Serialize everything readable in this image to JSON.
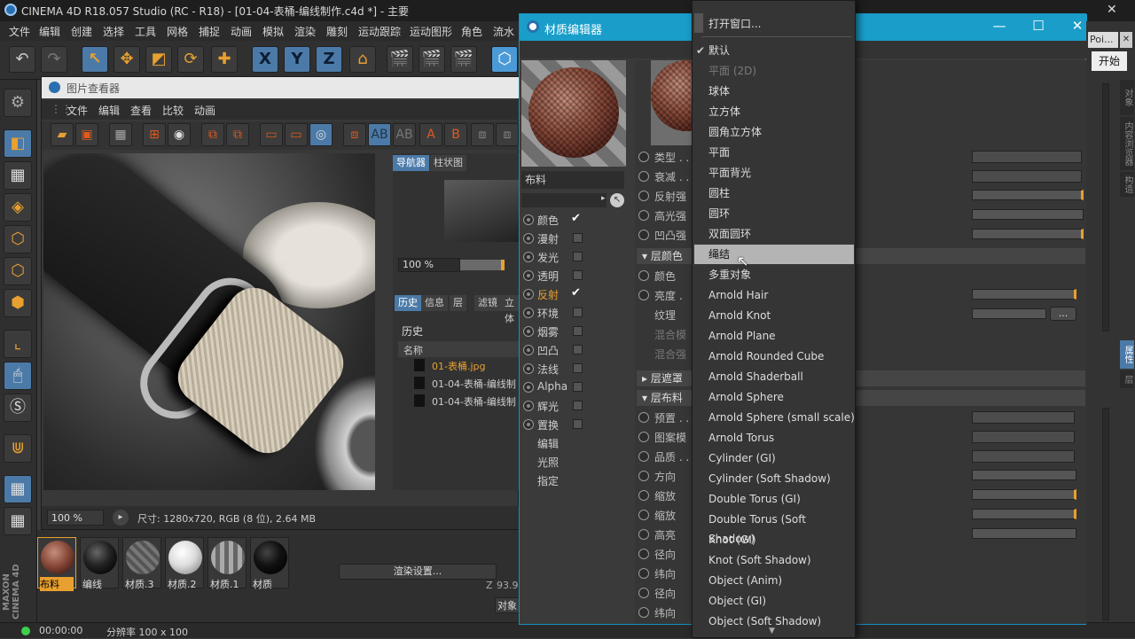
{
  "app": {
    "title": "CINEMA 4D R18.057 Studio (RC - R18) - [01-04-表桶-编线制作.c4d *] - 主要"
  },
  "menubar": [
    "文件",
    "编辑",
    "创建",
    "选择",
    "工具",
    "网格",
    "捕捉",
    "动画",
    "模拟",
    "渲染",
    "雕刻",
    "运动跟踪",
    "运动图形",
    "角色",
    "流水"
  ],
  "toolbar": {
    "x": "X",
    "y": "Y",
    "z": "Z"
  },
  "picture_viewer": {
    "title": "图片查看器",
    "menu": [
      "文件",
      "编辑",
      "查看",
      "比较",
      "动画"
    ],
    "nav_tabs": [
      "导航器",
      "柱状图"
    ],
    "zoom": "100 %",
    "info_tabs": [
      "历史",
      "信息",
      "层",
      "滤镜",
      "立体"
    ],
    "history_title": "历史",
    "history_col": "名称",
    "history_items": [
      "01-表桶.jpg",
      "01-04-表桶-编线制",
      "01-04-表桶-编线制"
    ],
    "bottom_zoom": "100 %",
    "size_info": "尺寸: 1280x720, RGB (8 位), 2.64 MB",
    "render_setting": "渲染设置...",
    "z_label": "Z",
    "z_value": "93.9",
    "obj_btn": "对象"
  },
  "materials": [
    {
      "name": "布料",
      "color": "#8a4a3a",
      "active": true
    },
    {
      "name": "编线",
      "color": "#2a2a2a",
      "active": false
    },
    {
      "name": "材质.3",
      "color": "#6e6e6e",
      "active": false
    },
    {
      "name": "材质.2",
      "color": "#e8e8e8",
      "active": false
    },
    {
      "name": "材质.1",
      "color": "#9a9a9a",
      "active": false
    },
    {
      "name": "材质",
      "color": "#1a1a1a",
      "active": false
    }
  ],
  "status": {
    "time": "00:00:00",
    "resolution": "分辨率 100 x 100"
  },
  "material_editor": {
    "title": "材质编辑器",
    "material_name": "布料",
    "channels": [
      {
        "name": "颜色",
        "checked": true,
        "active": false
      },
      {
        "name": "漫射",
        "checked": false,
        "active": false
      },
      {
        "name": "发光",
        "checked": false,
        "active": false
      },
      {
        "name": "透明",
        "checked": false,
        "active": false
      },
      {
        "name": "反射",
        "checked": true,
        "active": true
      },
      {
        "name": "环境",
        "checked": false,
        "active": false
      },
      {
        "name": "烟雾",
        "checked": false,
        "active": false
      },
      {
        "name": "凹凸",
        "checked": false,
        "active": false
      },
      {
        "name": "法线",
        "checked": false,
        "active": false
      },
      {
        "name": "Alpha",
        "checked": false,
        "active": false
      },
      {
        "name": "辉光",
        "checked": false,
        "active": false
      },
      {
        "name": "置换",
        "checked": false,
        "active": false
      }
    ],
    "sub_items": [
      "编辑",
      "光照",
      "指定"
    ],
    "props": {
      "type": "类型 . .",
      "atten": "衰减 . .",
      "refl": "反射强",
      "spec": "高光强",
      "bump": "凹凸强",
      "layer_color": "层颜色",
      "color": "颜色",
      "bright": "亮度 .",
      "texture": "纹理",
      "blend_mode": "混合模",
      "blend_str": "混合强",
      "layer_mask": "层遮罩",
      "layer_cloth": "层布料",
      "preset": "预置 . .",
      "pattern": "图案模",
      "quality": "品质 . .",
      "dir": "方向",
      "scale1": "缩放",
      "scale2": "缩放",
      "height": "高亮",
      "radius": "径向",
      "weft1": "纬向",
      "radius2": "径向",
      "weft2": "纬向",
      "dots": "..."
    }
  },
  "dropdown": {
    "items": [
      {
        "label": "打开窗口...",
        "state": "normal"
      },
      {
        "label": "默认",
        "state": "checked"
      },
      {
        "label": "平面 (2D)",
        "state": "disabled"
      },
      {
        "label": "球体",
        "state": "normal"
      },
      {
        "label": "立方体",
        "state": "normal"
      },
      {
        "label": "圆角立方体",
        "state": "normal"
      },
      {
        "label": "平面",
        "state": "normal"
      },
      {
        "label": "平面背光",
        "state": "normal"
      },
      {
        "label": "圆柱",
        "state": "normal"
      },
      {
        "label": "圆环",
        "state": "normal"
      },
      {
        "label": "双面圆环",
        "state": "normal"
      },
      {
        "label": "绳结",
        "state": "highlight"
      },
      {
        "label": "多重对象",
        "state": "normal"
      },
      {
        "label": "Arnold Hair",
        "state": "normal"
      },
      {
        "label": "Arnold Knot",
        "state": "normal"
      },
      {
        "label": "Arnold Plane",
        "state": "normal"
      },
      {
        "label": "Arnold Rounded Cube",
        "state": "normal"
      },
      {
        "label": "Arnold Shaderball",
        "state": "normal"
      },
      {
        "label": "Arnold Sphere",
        "state": "normal"
      },
      {
        "label": "Arnold Sphere (small scale)",
        "state": "normal"
      },
      {
        "label": "Arnold Torus",
        "state": "normal"
      },
      {
        "label": "Cylinder (GI)",
        "state": "normal"
      },
      {
        "label": "Cylinder (Soft Shadow)",
        "state": "normal"
      },
      {
        "label": "Double Torus (GI)",
        "state": "normal"
      },
      {
        "label": "Double Torus (Soft Shadow)",
        "state": "normal"
      },
      {
        "label": "Knot (GI)",
        "state": "normal"
      },
      {
        "label": "Knot (Soft Shadow)",
        "state": "normal"
      },
      {
        "label": "Object (Anim)",
        "state": "normal"
      },
      {
        "label": "Object (GI)",
        "state": "normal"
      },
      {
        "label": "Object (Soft Shadow)",
        "state": "normal"
      }
    ]
  },
  "side_panel": {
    "search": "Poi...",
    "start": "开始",
    "tabs": [
      "对象",
      "内容浏览器",
      "构造",
      "属性",
      "层"
    ]
  }
}
